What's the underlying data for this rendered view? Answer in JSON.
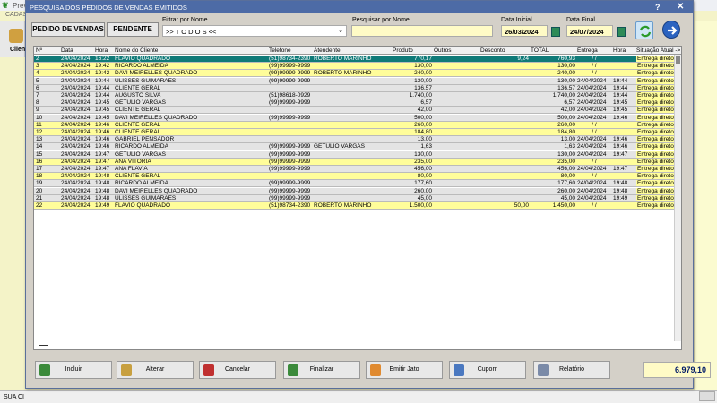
{
  "background": {
    "app_title": "Prev",
    "menu": "CADAS",
    "side_label": "Clien",
    "status": "SUA CI"
  },
  "dialog": {
    "title": "PESQUISA DOS PEDIDOS DE VENDAS EMITIDOS",
    "help": "?",
    "close": "✕"
  },
  "toolbar": {
    "orders_label": "PEDIDO DE VENDAS",
    "pending_label": "PENDENTE",
    "filter_label": "Filtrar por Nome",
    "filter_value": ">> T O D O S <<",
    "search_label": "Pesquisar por Nome",
    "search_value": "",
    "start_label": "Data Inicial",
    "start_value": "26/03/2024",
    "end_label": "Data Final",
    "end_value": "24/07/2024"
  },
  "columns": [
    "Nº",
    "Data",
    "Hora",
    "Nome do Cliente",
    "Telefone",
    "Atendente",
    "Produto",
    "Outros",
    "Desconto",
    "TOTAL",
    "Entrega",
    "Hora",
    "Situação Atual ->"
  ],
  "rows": [
    {
      "n": "2",
      "data": "24/04/2024",
      "hora": "16:22",
      "cliente": "FLAVIO QUADRADO",
      "tel": "(51)98734-2390",
      "atend": "ROBERTO MARINHO",
      "prod": "770,17",
      "outros": "",
      "desc": "9,24",
      "total": "760,93",
      "entrega": "/ /",
      "hora2": "",
      "sit": "Entrega direto para o cliente",
      "style": "sel"
    },
    {
      "n": "3",
      "data": "24/04/2024",
      "hora": "19:42",
      "cliente": "RICARDO ALMEIDA",
      "tel": "(99)99999-9999",
      "atend": "",
      "prod": "130,00",
      "outros": "",
      "desc": "",
      "total": "130,00",
      "entrega": "/ /",
      "hora2": "",
      "sit": "Entrega direto para o cliente",
      "style": "yel"
    },
    {
      "n": "4",
      "data": "24/04/2024",
      "hora": "19:42",
      "cliente": "DAVI MEIRELLES QUADRADO",
      "tel": "(99)99999-9999",
      "atend": "ROBERTO MARINHO",
      "prod": "240,00",
      "outros": "",
      "desc": "",
      "total": "240,00",
      "entrega": "/ /",
      "hora2": "",
      "sit": "Entrega direto para o cliente",
      "style": "yel"
    },
    {
      "n": "5",
      "data": "24/04/2024",
      "hora": "19:44",
      "cliente": "ULISSES GUIMARAES",
      "tel": "(99)99999-9999",
      "atend": "",
      "prod": "130,00",
      "outros": "",
      "desc": "",
      "total": "130,00",
      "entrega": "24/04/2024",
      "hora2": "19:44",
      "sit": "Entrega direto para o cliente",
      "style": "gry"
    },
    {
      "n": "6",
      "data": "24/04/2024",
      "hora": "19:44",
      "cliente": "CLIENTE GERAL",
      "tel": "",
      "atend": "",
      "prod": "136,57",
      "outros": "",
      "desc": "",
      "total": "136,57",
      "entrega": "24/04/2024",
      "hora2": "19:44",
      "sit": "Entrega direto para o cliente",
      "style": "gry"
    },
    {
      "n": "7",
      "data": "24/04/2024",
      "hora": "19:44",
      "cliente": "AUGUSTO SILVA",
      "tel": "(51)98618-0929",
      "atend": "",
      "prod": "1.740,00",
      "outros": "",
      "desc": "",
      "total": "1.740,00",
      "entrega": "24/04/2024",
      "hora2": "19:44",
      "sit": "Entrega direto para o cliente",
      "style": "gry"
    },
    {
      "n": "8",
      "data": "24/04/2024",
      "hora": "19:45",
      "cliente": "GETULIO VARGAS",
      "tel": "(99)99999-9999",
      "atend": "",
      "prod": "6,57",
      "outros": "",
      "desc": "",
      "total": "6,57",
      "entrega": "24/04/2024",
      "hora2": "19:45",
      "sit": "Entrega direto para o cliente",
      "style": "gry"
    },
    {
      "n": "9",
      "data": "24/04/2024",
      "hora": "19:45",
      "cliente": "CLIENTE GERAL",
      "tel": "",
      "atend": "",
      "prod": "42,00",
      "outros": "",
      "desc": "",
      "total": "42,00",
      "entrega": "24/04/2024",
      "hora2": "19:45",
      "sit": "Entrega direto para o cliente",
      "style": "gry"
    },
    {
      "n": "10",
      "data": "24/04/2024",
      "hora": "19:45",
      "cliente": "DAVI MEIRELLES QUADRADO",
      "tel": "(99)99999-9999",
      "atend": "",
      "prod": "500,00",
      "outros": "",
      "desc": "",
      "total": "500,00",
      "entrega": "24/04/2024",
      "hora2": "19:46",
      "sit": "Entrega direto para o cliente",
      "style": "gry"
    },
    {
      "n": "11",
      "data": "24/04/2024",
      "hora": "19:46",
      "cliente": "CLIENTE GERAL",
      "tel": "",
      "atend": "",
      "prod": "260,00",
      "outros": "",
      "desc": "",
      "total": "260,00",
      "entrega": "/ /",
      "hora2": "",
      "sit": "Entrega direto para o cliente",
      "style": "yel"
    },
    {
      "n": "12",
      "data": "24/04/2024",
      "hora": "19:46",
      "cliente": "CLIENTE GERAL",
      "tel": "",
      "atend": "",
      "prod": "184,80",
      "outros": "",
      "desc": "",
      "total": "184,80",
      "entrega": "/ /",
      "hora2": "",
      "sit": "Entrega direto para o cliente",
      "style": "yel"
    },
    {
      "n": "13",
      "data": "24/04/2024",
      "hora": "19:46",
      "cliente": "GABRIEL PENSADOR",
      "tel": "",
      "atend": "",
      "prod": "13,00",
      "outros": "",
      "desc": "",
      "total": "13,00",
      "entrega": "24/04/2024",
      "hora2": "19:46",
      "sit": "Entrega direto para o cliente",
      "style": "gry"
    },
    {
      "n": "14",
      "data": "24/04/2024",
      "hora": "19:46",
      "cliente": "RICARDO ALMEIDA",
      "tel": "(99)99999-9999",
      "atend": "GETULIO VARGAS",
      "prod": "1,63",
      "outros": "",
      "desc": "",
      "total": "1,63",
      "entrega": "24/04/2024",
      "hora2": "19:46",
      "sit": "Entrega direto para o cliente",
      "style": "gry"
    },
    {
      "n": "15",
      "data": "24/04/2024",
      "hora": "19:47",
      "cliente": "GETULIO VARGAS",
      "tel": "(99)99999-9999",
      "atend": "",
      "prod": "130,00",
      "outros": "",
      "desc": "",
      "total": "130,00",
      "entrega": "24/04/2024",
      "hora2": "19:47",
      "sit": "Entrega direto para o cliente",
      "style": "gry"
    },
    {
      "n": "16",
      "data": "24/04/2024",
      "hora": "19:47",
      "cliente": "ANA VITORIA",
      "tel": "(99)99999-9999",
      "atend": "",
      "prod": "235,00",
      "outros": "",
      "desc": "",
      "total": "235,00",
      "entrega": "/ /",
      "hora2": "",
      "sit": "Entrega direto para o cliente",
      "style": "yel"
    },
    {
      "n": "17",
      "data": "24/04/2024",
      "hora": "19:47",
      "cliente": "ANA FLAVIA",
      "tel": "(99)99999-9999",
      "atend": "",
      "prod": "456,00",
      "outros": "",
      "desc": "",
      "total": "456,00",
      "entrega": "24/04/2024",
      "hora2": "19:47",
      "sit": "Entrega direto para o cliente",
      "style": "gry"
    },
    {
      "n": "18",
      "data": "24/04/2024",
      "hora": "19:48",
      "cliente": "CLIENTE GERAL",
      "tel": "",
      "atend": "",
      "prod": "80,00",
      "outros": "",
      "desc": "",
      "total": "80,00",
      "entrega": "/ /",
      "hora2": "",
      "sit": "Entrega direto para o cliente",
      "style": "yel"
    },
    {
      "n": "19",
      "data": "24/04/2024",
      "hora": "19:48",
      "cliente": "RICARDO ALMEIDA",
      "tel": "(99)99999-9999",
      "atend": "",
      "prod": "177,60",
      "outros": "",
      "desc": "",
      "total": "177,60",
      "entrega": "24/04/2024",
      "hora2": "19:48",
      "sit": "Entrega direto para o cliente",
      "style": "gry"
    },
    {
      "n": "20",
      "data": "24/04/2024",
      "hora": "19:48",
      "cliente": "DAVI MEIRELLES QUADRADO",
      "tel": "(99)99999-9999",
      "atend": "",
      "prod": "260,00",
      "outros": "",
      "desc": "",
      "total": "260,00",
      "entrega": "24/04/2024",
      "hora2": "19:48",
      "sit": "Entrega direto para o cliente",
      "style": "gry"
    },
    {
      "n": "21",
      "data": "24/04/2024",
      "hora": "19:48",
      "cliente": "ULISSES GUIMARAES",
      "tel": "(99)99999-9999",
      "atend": "",
      "prod": "45,00",
      "outros": "",
      "desc": "",
      "total": "45,00",
      "entrega": "24/04/2024",
      "hora2": "19:49",
      "sit": "Entrega direto para o cliente",
      "style": "gry"
    },
    {
      "n": "22",
      "data": "24/04/2024",
      "hora": "19:49",
      "cliente": "FLAVIO QUADRADO",
      "tel": "(51)98734-2390",
      "atend": "ROBERTO MARINHO",
      "prod": "1.500,00",
      "outros": "",
      "desc": "50,00",
      "total": "1.450,00",
      "entrega": "/ /",
      "hora2": "",
      "sit": "Entrega direto para o cliente",
      "style": "yel"
    }
  ],
  "buttons": [
    {
      "id": "incluir",
      "label": "Incluir",
      "icon": "add-doc-icon",
      "color": "#3b8a3b"
    },
    {
      "id": "alterar",
      "label": "Alterar",
      "icon": "pencil-icon",
      "color": "#c8a040"
    },
    {
      "id": "cancelar",
      "label": "Cancelar",
      "icon": "cancel-doc-icon",
      "color": "#c03030"
    },
    {
      "id": "finalizar",
      "label": "Finalizar",
      "icon": "check-doc-icon",
      "color": "#3b8a3b"
    },
    {
      "id": "emitir",
      "label": "Emitir Jato",
      "icon": "printer-person-icon",
      "color": "#e08a30"
    },
    {
      "id": "cupom",
      "label": "Cupom",
      "icon": "receipt-icon",
      "color": "#4a78c0"
    },
    {
      "id": "relatorio",
      "label": "Relatório",
      "icon": "printer-icon",
      "color": "#7a8aa8"
    }
  ],
  "grand_total": "6.979,10",
  "colors": {
    "title_bar": "#4d6ba6",
    "selected_row": "#0f7a78",
    "yellow_row": "#fffd9a",
    "gray_row": "#e4e4e4"
  }
}
